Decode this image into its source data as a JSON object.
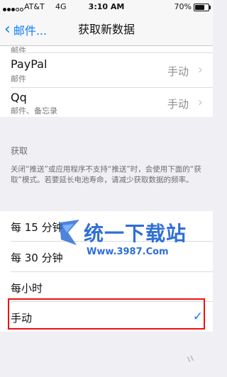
{
  "status_bar": {
    "carrier": "AT&T",
    "network": "4G",
    "time": "3:10 AM",
    "battery": "70%",
    "battery_level": 0.7
  },
  "nav": {
    "back_label": "邮件...",
    "title": "获取新数据"
  },
  "accounts": [
    {
      "title": "",
      "subtitle": "邮件",
      "value": ""
    },
    {
      "title": "PayPal",
      "subtitle": "邮件",
      "value": "手动"
    },
    {
      "title": "Qq",
      "subtitle": "邮件、备忘录",
      "value": "手动"
    }
  ],
  "fetch_section": {
    "header": "获取",
    "note": "关闭“推送”或应用程序不支持“推送”时，会使用下面的“获取”模式。若要延长电池寿命，请减少获取数据的频率。"
  },
  "fetch_options": [
    {
      "label": "每 15 分钟",
      "selected": false
    },
    {
      "label": "每 30 分钟",
      "selected": false
    },
    {
      "label": "每小时",
      "selected": false
    },
    {
      "label": "手动",
      "selected": true
    }
  ],
  "watermark": {
    "brand": "统一下载站",
    "url": "Www.3987.Com"
  },
  "colors": {
    "accent": "#0a7aff",
    "highlight_border": "#e11111",
    "watermark": "#2f6fd6"
  }
}
